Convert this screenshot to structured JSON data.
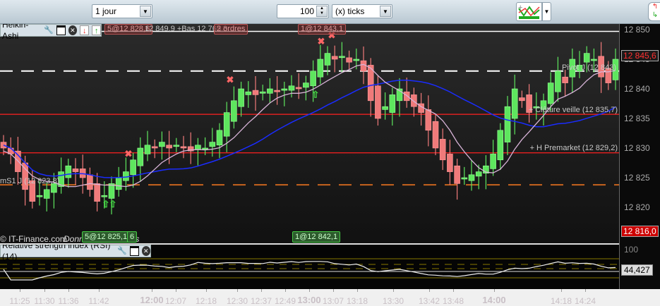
{
  "toolbar": {
    "period": "1 jour",
    "tick_count": "100",
    "tick_unit": "(x) ticks"
  },
  "chart": {
    "legend": "Heikin-Ashi",
    "rsi_legend": "Relative strength index (RSI) (14)",
    "copyright": "© IT-Finance.com",
    "disclaimer": "Données indicatives",
    "order_tags": [
      "5@12 828,6",
      "2 ordres",
      "1@12 843,1"
    ],
    "order_line_text": "12 849,9 +Bas 12 765,3",
    "green_tags": [
      "5@12 825,1",
      "6",
      "1@12 842,1"
    ],
    "levels": [
      {
        "label": "Pivot J (12 843)",
        "value": 12843,
        "color": "#ffffff",
        "style": "dashed"
      },
      {
        "label": "+ Clôture veille  (12 835,7)",
        "value": 12835.7,
        "color": "#ff2020",
        "style": "solid"
      },
      {
        "label": "+ H Premarket (12 829,2)",
        "value": 12829.2,
        "color": "#ff2020",
        "style": "solid"
      },
      {
        "label": "mS1 J (12 823,8)",
        "value": 12823.8,
        "color": "#c8641e",
        "style": "dashed"
      }
    ],
    "price_axis": [
      "12 850",
      "12 845",
      "12 840",
      "12 835",
      "12 830",
      "12 825",
      "12 820"
    ],
    "price_ticks": [
      12850,
      12845,
      12840,
      12835,
      12830,
      12825,
      12820
    ],
    "last_price": "12 845,6",
    "last_value": 12845.6,
    "low_marker": "12 816,0",
    "low_value": 12816.0,
    "rsi_axis_top": "100",
    "rsi_value": "44,427",
    "time_axis": [
      {
        "t": "11:25",
        "b": false
      },
      {
        "t": "11:30",
        "b": false
      },
      {
        "t": "11:36",
        "b": false
      },
      {
        "t": "11:42",
        "b": false
      },
      {
        "t": "12:00",
        "b": true
      },
      {
        "t": "12:07",
        "b": false
      },
      {
        "t": "12:18",
        "b": false
      },
      {
        "t": "12:30",
        "b": false
      },
      {
        "t": "12:37",
        "b": false
      },
      {
        "t": "12:49",
        "b": false
      },
      {
        "t": "13:00",
        "b": true
      },
      {
        "t": "13:07",
        "b": false
      },
      {
        "t": "13:18",
        "b": false
      },
      {
        "t": "13:30",
        "b": false
      },
      {
        "t": "13:42",
        "b": false
      },
      {
        "t": "13:48",
        "b": false
      },
      {
        "t": "14:00",
        "b": true
      },
      {
        "t": "14:18",
        "b": false
      },
      {
        "t": "14:24",
        "b": false
      }
    ],
    "closes": [
      12830,
      12829,
      12826,
      12823,
      12821,
      12822,
      12823,
      12824,
      12826,
      12827,
      12826,
      12825,
      12823,
      12821,
      12822,
      12824,
      12825,
      12826,
      12828,
      12830,
      12830.5,
      12830,
      12831,
      12830,
      12830.5,
      12830,
      12829.5,
      12830.5,
      12830,
      12831,
      12833,
      12836,
      12838,
      12840,
      12839.5,
      12839,
      12839.5,
      12840,
      12839.5,
      12840,
      12840.5,
      12840,
      12841,
      12843,
      12845,
      12846,
      12845,
      12845.5,
      12844.5,
      12845,
      12843,
      12838,
      12835,
      12837,
      12839,
      12840,
      12838,
      12837,
      12836,
      12833,
      12830,
      12828,
      12826,
      12824,
      12825,
      12825.5,
      12826,
      12827,
      12829,
      12833,
      12837,
      12840,
      12838,
      12836,
      12837,
      12838,
      12841,
      12843,
      12841,
      12845,
      12844,
      12846,
      12845,
      12842,
      12841,
      12845
    ],
    "colors": {
      "up": "#5ee65e",
      "down": "#f07a7a",
      "ma_fast": "#d8b4d8",
      "ma_slow": "#1a2cff"
    }
  }
}
